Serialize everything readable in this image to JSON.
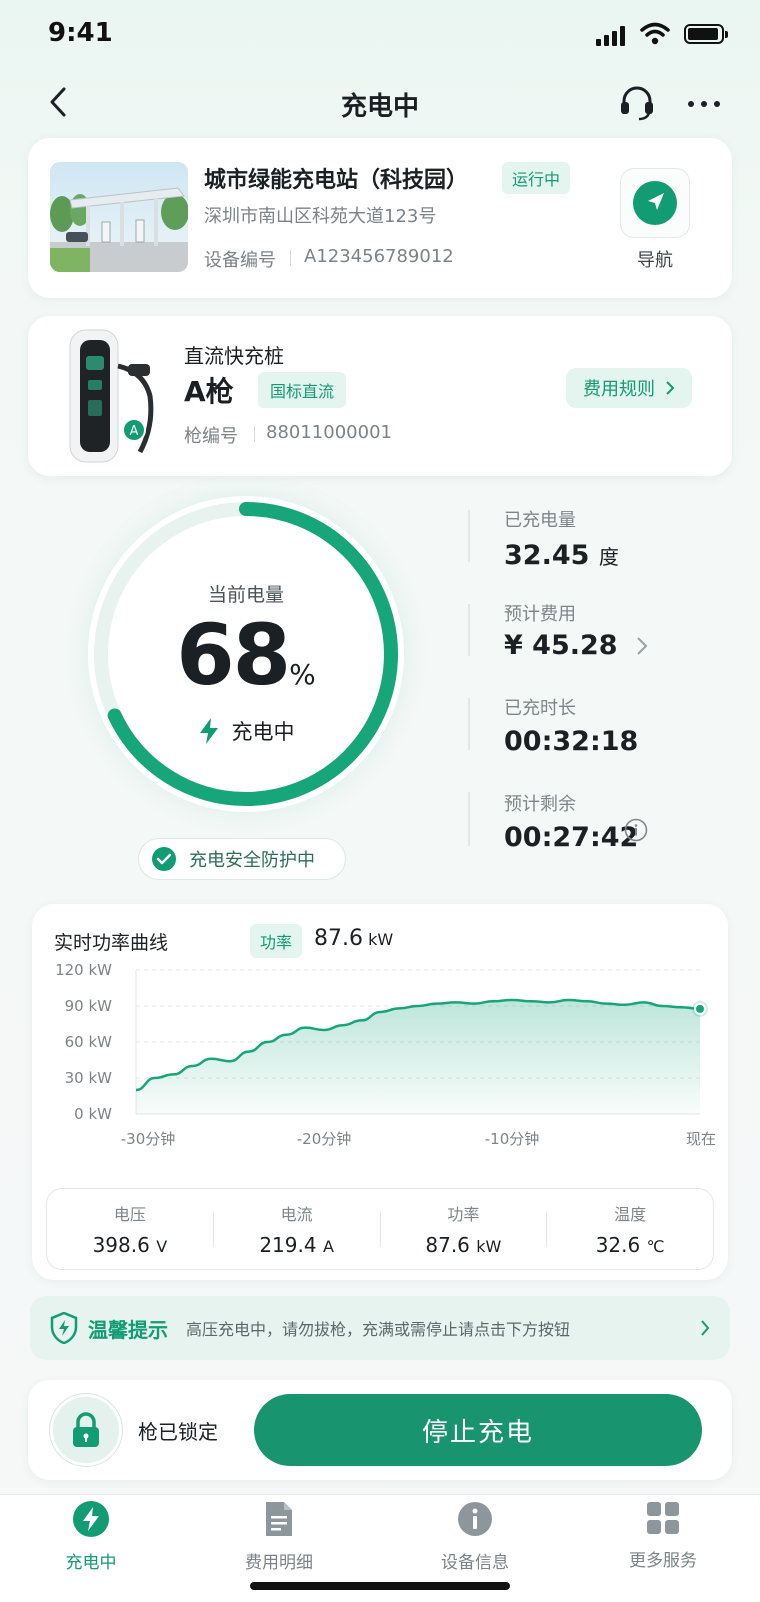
{
  "status_bar": {
    "time": "9:41"
  },
  "nav": {
    "title": "充电中"
  },
  "station": {
    "name": "城市绿能充电站（科技园）",
    "status_tag": "运行中",
    "address": "深圳市南山区科苑大道123号",
    "device_label": "设备编号",
    "device_id": "A123456789012",
    "nav_label": "导航"
  },
  "connector": {
    "type": "直流快充桩",
    "gun": "A枪",
    "standard_tag": "国标直流",
    "gun_no_label": "枪编号",
    "gun_no": "88011000001",
    "fee_rule_label": "费用规则",
    "gun_badge": "A"
  },
  "charging": {
    "current_label": "当前电量",
    "percent": "68",
    "percent_value": 68,
    "percent_sign": "%",
    "state": "充电中",
    "safety": "充电安全防护中",
    "stats": [
      {
        "label": "已充电量",
        "value": "32.45",
        "unit": "度"
      },
      {
        "label": "预计费用",
        "value": "¥ 45.28",
        "unit": ""
      },
      {
        "label": "已充时长",
        "value": "00:32:18",
        "unit": ""
      },
      {
        "label": "预计剩余",
        "value": "00:27:42",
        "unit": ""
      }
    ]
  },
  "power": {
    "title": "实时功率曲线",
    "tag": "功率",
    "current_value": "87.6",
    "current_unit": "kW",
    "metrics": [
      {
        "label": "电压",
        "value": "398.6",
        "unit": "V"
      },
      {
        "label": "电流",
        "value": "219.4",
        "unit": "A"
      },
      {
        "label": "功率",
        "value": "87.6",
        "unit": "kW"
      },
      {
        "label": "温度",
        "value": "32.6",
        "unit": "℃"
      }
    ]
  },
  "chart_data": {
    "type": "area",
    "title": "实时功率曲线",
    "xlabel": "",
    "ylabel": "",
    "y_ticks": [
      "120 kW",
      "90 kW",
      "60 kW",
      "30 kW",
      "0 kW"
    ],
    "x_ticks": [
      "-30分钟",
      "-20分钟",
      "-10分钟",
      "现在"
    ],
    "xlim": [
      -30,
      0
    ],
    "ylim": [
      0,
      120
    ],
    "grid": true,
    "series": [
      {
        "values_x": [
          -30,
          -29,
          -28,
          -27,
          -26,
          -25,
          -24,
          -23,
          -22,
          -21,
          -20,
          -19,
          -18,
          -17,
          -16,
          -15,
          -14,
          -13,
          -12,
          -11,
          -10,
          -9,
          -8,
          -7,
          -6,
          -5,
          -4,
          -3,
          -2,
          -1,
          0
        ],
        "values_y": [
          20,
          30,
          33,
          40,
          46,
          44,
          52,
          60,
          66,
          72,
          70,
          74,
          78,
          85,
          88,
          90,
          92,
          93,
          92,
          94,
          95,
          94,
          93,
          95,
          94,
          92,
          91,
          93,
          90,
          89,
          87.6
        ]
      }
    ]
  },
  "tip": {
    "title": "温馨提示",
    "text": "高压充电中，请勿拔枪，充满或需停止请点击下方按钮"
  },
  "action": {
    "lock_label": "枪已锁定",
    "stop_button": "停止充电"
  },
  "tabs": [
    {
      "label": "充电中",
      "icon": "bolt-icon",
      "active": true
    },
    {
      "label": "费用明细",
      "icon": "document-icon",
      "active": false
    },
    {
      "label": "设备信息",
      "icon": "info-icon",
      "active": false
    },
    {
      "label": "更多服务",
      "icon": "grid-icon",
      "active": false
    }
  ],
  "colors": {
    "accent": "#129c73",
    "accent_light": "#e4f4ee",
    "text": "#1b2024",
    "muted": "#7e868b"
  }
}
